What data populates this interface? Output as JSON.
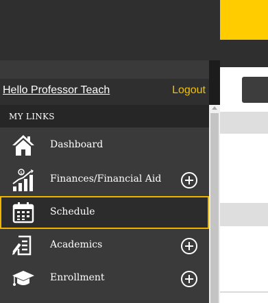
{
  "header": {
    "greeting": "Hello Professor Teach",
    "logout_label": "Logout"
  },
  "sidebar": {
    "section_title": "MY LINKS",
    "items": [
      {
        "label": "Dashboard",
        "icon": "home-icon",
        "expandable": false,
        "selected": false
      },
      {
        "label": "Finances/Financial Aid",
        "icon": "finance-chart-icon",
        "expandable": true,
        "selected": false
      },
      {
        "label": "Schedule",
        "icon": "calendar-icon",
        "expandable": false,
        "selected": true
      },
      {
        "label": "Academics",
        "icon": "academics-icon",
        "expandable": true,
        "selected": false
      },
      {
        "label": "Enrollment",
        "icon": "graduation-cap-icon",
        "expandable": true,
        "selected": false
      }
    ]
  },
  "colors": {
    "accent": "#ffcc00",
    "logout": "#f2c200",
    "selected_border": "#f0b400",
    "sidebar_bg": "#3a3a3a",
    "section_header_bg": "#262626"
  }
}
